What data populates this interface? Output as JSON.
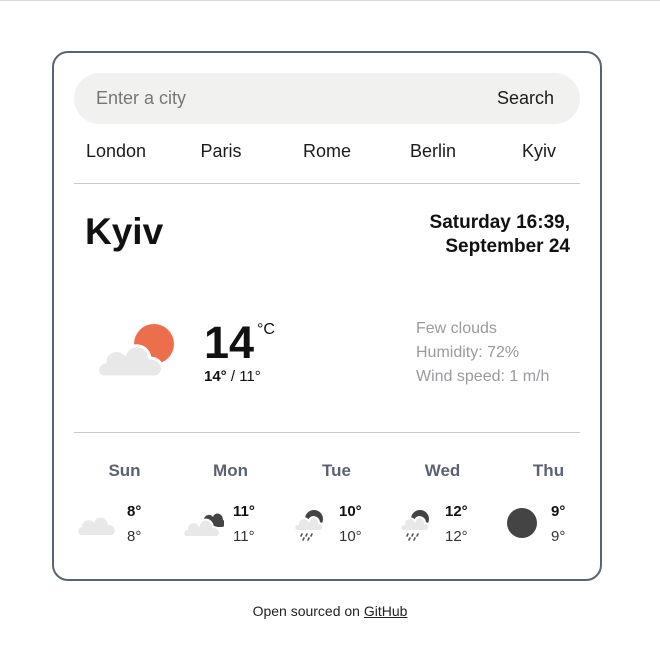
{
  "search": {
    "placeholder": "Enter a city",
    "value": "",
    "button_label": "Search"
  },
  "quick_cities": [
    "London",
    "Paris",
    "Rome",
    "Berlin",
    "Kyiv"
  ],
  "current": {
    "city": "Kyiv",
    "date_line1": "Saturday 16:39,",
    "date_line2": "September 24",
    "icon": "few-clouds-day-icon",
    "temperature": "14",
    "unit": "°C",
    "max": "14°",
    "min": "11°",
    "description": "Few clouds",
    "humidity": "Humidity: 72%",
    "wind": "Wind speed: 1 m/h"
  },
  "forecast": [
    {
      "day": "Sun",
      "icon": "cloud-icon",
      "max": "8°",
      "min": "8°"
    },
    {
      "day": "Mon",
      "icon": "broken-clouds-icon",
      "max": "11°",
      "min": "11°"
    },
    {
      "day": "Tue",
      "icon": "rain-cloud-icon",
      "max": "10°",
      "min": "10°"
    },
    {
      "day": "Wed",
      "icon": "rain-cloud-icon",
      "max": "12°",
      "min": "12°"
    },
    {
      "day": "Thu",
      "icon": "dark-circle-icon",
      "max": "9°",
      "min": "9°"
    }
  ],
  "footer": {
    "prefix": "Open sourced on",
    "link": "GitHub"
  },
  "colors": {
    "accent_sun": "#ec6e4c",
    "cloud": "#e8e8e8",
    "dark_cloud": "#444444",
    "border": "#5a6472",
    "muted": "#9a9a9f"
  }
}
